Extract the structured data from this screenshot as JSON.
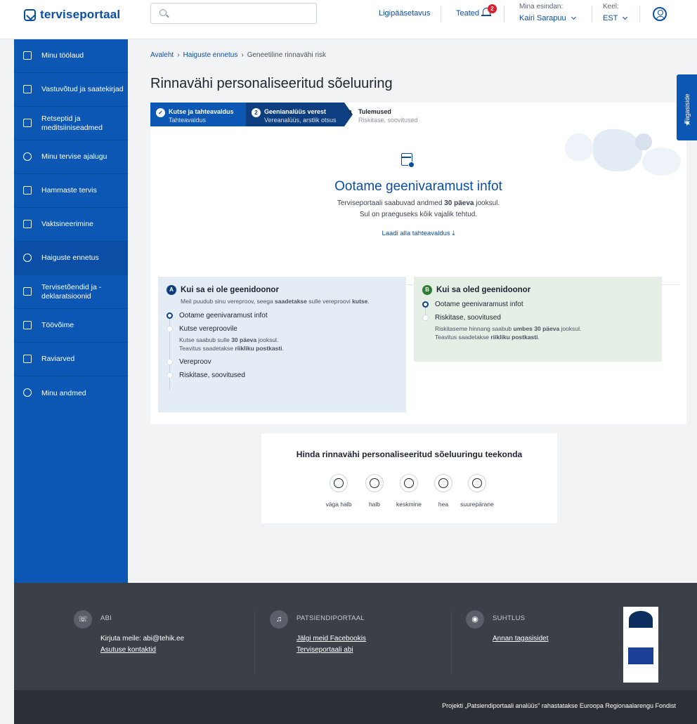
{
  "header": {
    "logo": "terviseportaal",
    "search_placeholder": "",
    "accessibility": "Ligipääsetavus",
    "notifications_label": "Teated",
    "notifications_count": "2",
    "representing_label": "Mina esindan:",
    "representing_value": "Kairi Sarapuu",
    "language_label": "Keel:",
    "language_value": "EST"
  },
  "sidebar": {
    "items": [
      {
        "label": "Minu töölaud",
        "icon": "dashboard-icon"
      },
      {
        "label": "Vastuvõtud ja saatekirjad",
        "icon": "calendar-icon"
      },
      {
        "label": "Retseptid ja meditsiiniseadmed",
        "icon": "prescription-icon"
      },
      {
        "label": "Minu tervise ajalugu",
        "icon": "history-icon"
      },
      {
        "label": "Hammaste tervis",
        "icon": "tooth-icon"
      },
      {
        "label": "Vaktsineerimine",
        "icon": "vaccine-icon"
      },
      {
        "label": "Haiguste ennetus",
        "icon": "heartbeat-icon"
      },
      {
        "label": "Tervisetõendid ja -deklaratsioonid",
        "icon": "clipboard-icon"
      },
      {
        "label": "Töövõime",
        "icon": "briefcase-icon"
      },
      {
        "label": "Raviarved",
        "icon": "card-icon"
      },
      {
        "label": "Minu andmed",
        "icon": "settings-icon"
      }
    ]
  },
  "breadcrumb": {
    "home": "Avaleht",
    "section": "Haiguste ennetus",
    "current": "Geneetiline rinnavähi risk"
  },
  "page_title": "Rinnavähi personaliseeritud sõeluuring",
  "steps": [
    {
      "title": "Kutse ja tahteavaldus",
      "subtitle": "Tahteavaldus",
      "state": "done"
    },
    {
      "number": "2",
      "title": "Geenianalüüs verest",
      "subtitle": "Vereanalüüs, arstlik otsus",
      "state": "active"
    },
    {
      "number": "3",
      "title": "Tulemused",
      "subtitle": "Riskitase, soovitused",
      "state": "upcoming"
    }
  ],
  "status": {
    "title": "Ootame geenivaramust infot",
    "line1_prefix": "Terviseportaali saabuvad andmed ",
    "line1_bold": "30 päeva",
    "line1_suffix": " jooksul.",
    "line2": "Sul on praeguseks kõik vajalik tehtud.",
    "download_link": "Laadi alla tahteavaldus"
  },
  "panel_a": {
    "badge": "A",
    "title": "Kui sa ei ole geenidoonor",
    "subtitle_prefix": "Meil puudub sinu vereproov, seega ",
    "subtitle_bold1": "saadetakse",
    "subtitle_mid": " sulle vereproovi ",
    "subtitle_bold2": "kutse",
    "subtitle_suffix": ".",
    "steps": [
      {
        "label": "Ootame geenivaramust infot"
      },
      {
        "label": "Kutse vereproovile"
      },
      {
        "label": "Vereproov"
      },
      {
        "label": "Riskitase, soovitused"
      }
    ],
    "note1_prefix": "Kutse saabub sulle ",
    "note1_bold": "30 päeva",
    "note1_suffix": " jooksul.",
    "note2_prefix": "Teavitus saadetakse ",
    "note2_bold": "riikliku postkasti",
    "note2_suffix": "."
  },
  "panel_b": {
    "badge": "B",
    "title": "Kui sa oled geenidoonor",
    "steps": [
      {
        "label": "Ootame geenivaramust infot"
      },
      {
        "label": "Riskitase, soovitused"
      }
    ],
    "note1_prefix": "Riskitaseme hinnang saabub ",
    "note1_bold": "umbes 30 päeva",
    "note1_suffix": " jooksul.",
    "note2_prefix": "Teavitus saadetakse ",
    "note2_bold": "riikliku postkasti",
    "note2_suffix": "."
  },
  "rating": {
    "title": "Hinda rinnavähi personaliseeritud sõeluuringu teekonda",
    "options": [
      "väga halb",
      "halb",
      "keskmine",
      "hea",
      "suurepärane"
    ]
  },
  "feedback_tab": "Tagasiside",
  "footer": {
    "abi_heading": "ABI",
    "abi_text": "Kirjuta meile: abi@tehik.ee",
    "abi_link": "Asutuse kontaktid",
    "portal_heading": "PATSIENDIPORTAAL",
    "portal_link1": "Jälgi meid Facebookis",
    "portal_link2": "Terviseportaali abi",
    "contact_heading": "SUHTLUS",
    "contact_link": "Annan tagasisidet",
    "bottom_text": "Projekti „Patsiendiportaali analüüs\" rahastatakse Euroopa Regionaalarengu Fondist"
  },
  "colors": {
    "primary": "#0b57b3",
    "primary_dark": "#0d3e7f",
    "footer": "#3b3f47"
  }
}
